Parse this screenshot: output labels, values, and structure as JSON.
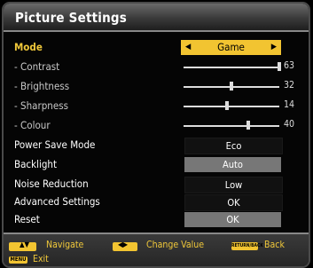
{
  "title": "Picture Settings",
  "mode": {
    "label": "Mode",
    "value": "Game"
  },
  "sliders": [
    {
      "label": "- Contrast",
      "value": 63,
      "fill": 1.0
    },
    {
      "label": "- Brightness",
      "value": 32,
      "fill": 0.5
    },
    {
      "label": "- Sharpness",
      "value": 14,
      "fill": 0.45
    },
    {
      "label": "- Colour",
      "value": 40,
      "fill": 0.68
    }
  ],
  "options": [
    {
      "label": "Power Save Mode",
      "value": "Eco",
      "style": "dark"
    },
    {
      "label": "Backlight",
      "value": "Auto",
      "style": "grey"
    },
    {
      "label": "Noise Reduction",
      "value": "Low",
      "style": "dark"
    },
    {
      "label": "Advanced Settings",
      "value": "OK",
      "style": "dark"
    },
    {
      "label": "Reset",
      "value": "OK",
      "style": "grey"
    }
  ],
  "footer": {
    "navigate": "Navigate",
    "change_value": "Change Value",
    "back_key": "RETURN/BACK",
    "back": "Back",
    "menu_key": "MENU",
    "exit": "Exit"
  },
  "colors": {
    "accent": "#f2c431",
    "label_yellow": "#f0c83a"
  }
}
